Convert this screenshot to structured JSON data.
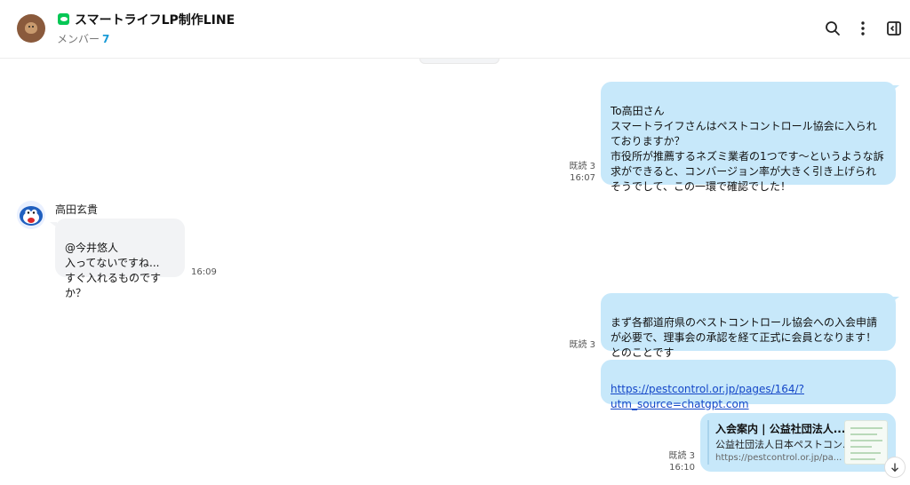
{
  "header": {
    "group_title": "スマートライフLP制作LINE",
    "members_label": "メンバー",
    "members_count": "7",
    "icons": [
      "search-icon",
      "more-vertical-icon",
      "sidebar-toggle-icon"
    ],
    "accent_color": "#1a9bd7",
    "line_green": "#06c755"
  },
  "messages": [
    {
      "direction": "outgoing",
      "text": "To高田さん\nスマートライフさんはペストコントロール協会に入られておりますか？\n市役所が推薦するネズミ業者の1つです〜というような訴求ができると、コンバージョン率が大きく引き上げられそうでして、この一環で確認でした！",
      "read": "既読 3",
      "time": "16:07"
    },
    {
      "direction": "incoming",
      "sender": "高田玄貴",
      "text": "@今井悠人\n入ってないですね...\nすぐ入れるものですか？",
      "time": "16:09"
    },
    {
      "direction": "outgoing",
      "text": "まず各都道府県のペストコントロール協会への入会申請が必要で、理事会の承認を経て正式に会員となります！とのことです",
      "read": "既読 3"
    },
    {
      "direction": "outgoing",
      "link": "https://pestcontrol.or.jp/pages/164/?utm_source=chatgpt.com"
    },
    {
      "direction": "outgoing",
      "card": {
        "title": "入会案内 | 公益社団法人...",
        "subtitle": "公益社団法人日本ペストコン...",
        "url": "https://pestcontrol.or.jp/pa..."
      },
      "read": "既読 3",
      "time": "16:10"
    }
  ],
  "colors": {
    "outgoing_bubble": "#c7e8fa",
    "incoming_bubble": "#f2f3f5",
    "link": "#1447c8"
  }
}
